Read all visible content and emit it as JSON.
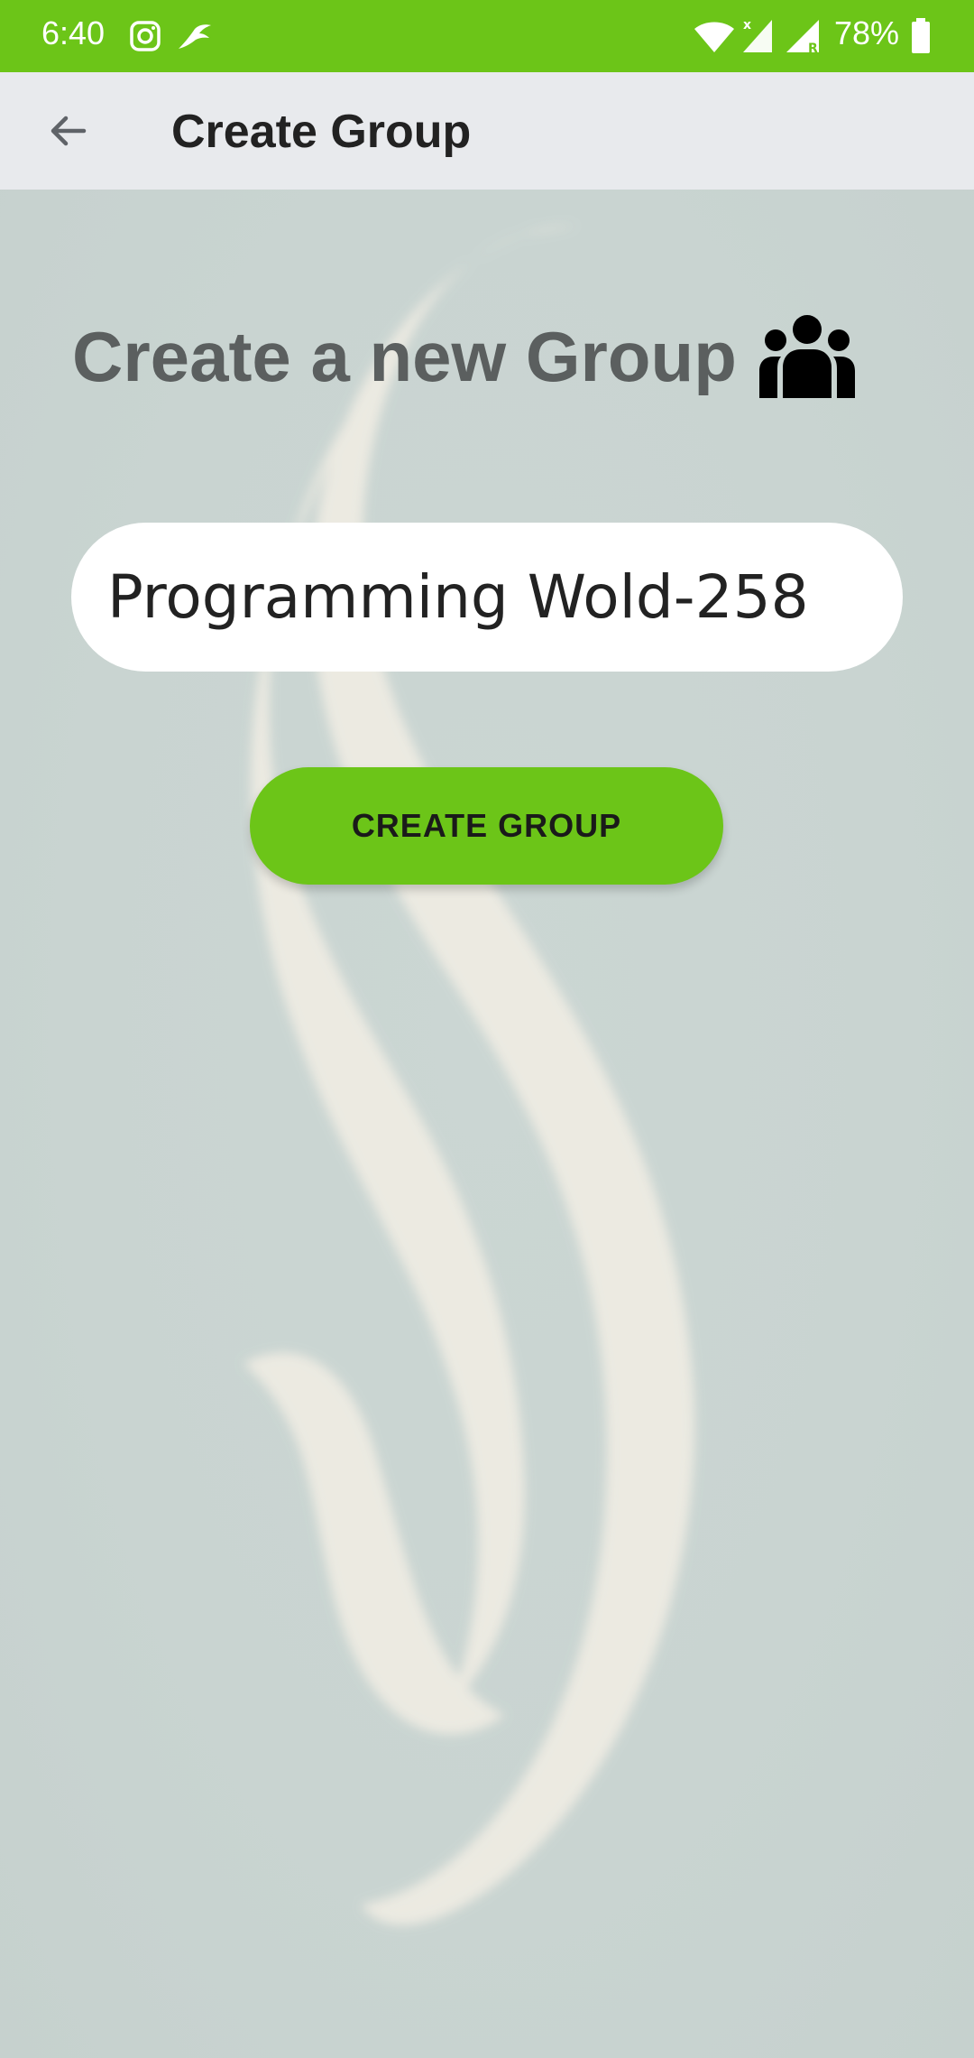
{
  "status_bar": {
    "time": "6:40",
    "battery": "78%",
    "icons": [
      "instagram-icon",
      "bird-icon",
      "wifi-icon",
      "cell-signal-icon",
      "cell-signal-roaming-icon",
      "battery-icon"
    ],
    "color": "#6cc518"
  },
  "app_bar": {
    "back_icon": "arrow-back-icon",
    "title": "Create Group"
  },
  "main": {
    "heading": "Create a new Group",
    "heading_icon": "users-group-icon",
    "group_name_input": {
      "value": "Programming Wold-258"
    },
    "create_button_label": "CREATE GROUP"
  },
  "colors": {
    "accent": "#6cc518",
    "background": "#c8d3d0",
    "app_bar": "#e8eaed",
    "heading_text": "#5b5f5f"
  }
}
